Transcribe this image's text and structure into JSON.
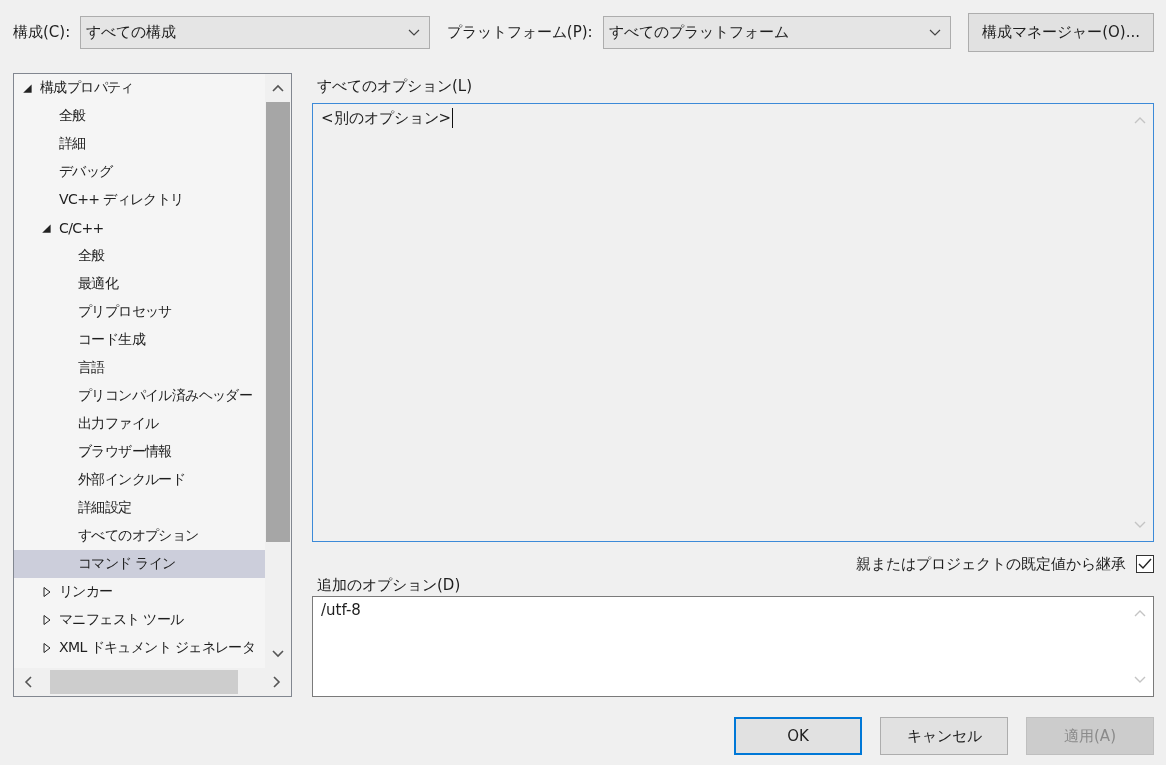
{
  "toolbar": {
    "configuration_label": "構成(C):",
    "configuration_value": "すべての構成",
    "platform_label": "プラットフォーム(P):",
    "platform_value": "すべてのプラットフォーム",
    "manager_button": "構成マネージャー(O)..."
  },
  "tree": [
    {
      "label": "構成プロパティ",
      "expanded": true,
      "selected": false,
      "children": [
        {
          "label": "全般",
          "selected": false
        },
        {
          "label": "詳細",
          "selected": false
        },
        {
          "label": "デバッグ",
          "selected": false
        },
        {
          "label": "VC++ ディレクトリ",
          "selected": false
        },
        {
          "label": "C/C++",
          "expanded": true,
          "selected": false,
          "children": [
            {
              "label": "全般",
              "selected": false
            },
            {
              "label": "最適化",
              "selected": false
            },
            {
              "label": "プリプロセッサ",
              "selected": false
            },
            {
              "label": "コード生成",
              "selected": false
            },
            {
              "label": "言語",
              "selected": false
            },
            {
              "label": "プリコンパイル済みヘッダー",
              "selected": false
            },
            {
              "label": "出力ファイル",
              "selected": false
            },
            {
              "label": "ブラウザー情報",
              "selected": false
            },
            {
              "label": "外部インクルード",
              "selected": false
            },
            {
              "label": "詳細設定",
              "selected": false
            },
            {
              "label": "すべてのオプション",
              "selected": false
            },
            {
              "label": "コマンド ライン",
              "selected": true
            }
          ]
        },
        {
          "label": "リンカー",
          "expanded": false,
          "selected": false
        },
        {
          "label": "マニフェスト ツール",
          "expanded": false,
          "selected": false
        },
        {
          "label": "XML ドキュメント ジェネレータ",
          "expanded": false,
          "selected": false
        }
      ]
    }
  ],
  "all_options": {
    "label": "すべてのオプション(L)",
    "value": "<別のオプション>"
  },
  "inherit": {
    "label": "親またはプロジェクトの既定値から継承",
    "checked": true
  },
  "additional_options": {
    "label": "追加のオプション(D)",
    "value": "/utf-8"
  },
  "buttons": [
    {
      "label": "OK",
      "kind": "default",
      "disabled": false
    },
    {
      "label": "キャンセル",
      "kind": "normal",
      "disabled": false
    },
    {
      "label": "適用(A)",
      "kind": "normal",
      "disabled": true
    }
  ]
}
